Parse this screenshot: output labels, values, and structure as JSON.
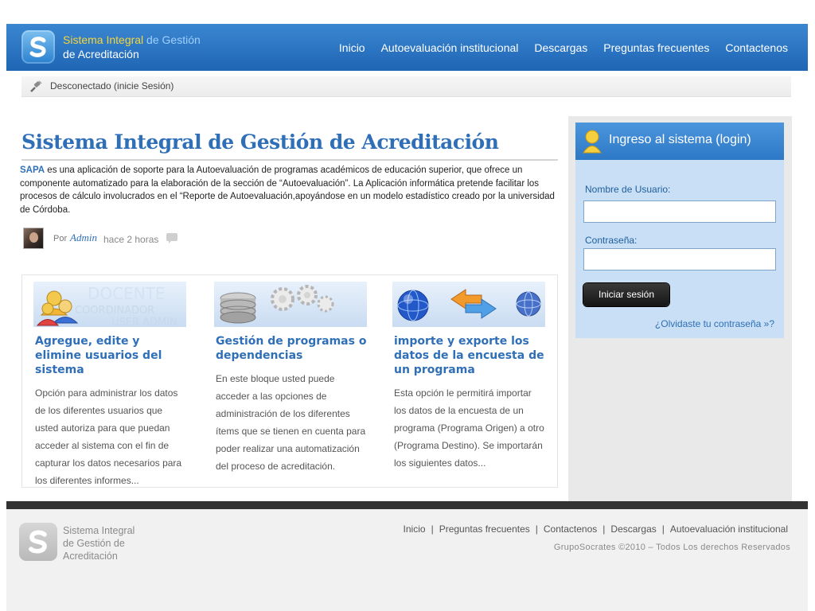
{
  "header": {
    "brand_line1_a": "Sistema Integral",
    "brand_line1_b": " de Gestión",
    "brand_line2": "de Acreditación",
    "nav": [
      "Inicio",
      "Autoevaluación institucional",
      "Descargas",
      "Preguntas frecuentes",
      "Contactenos"
    ]
  },
  "status": {
    "text": "Desconectado (inicie Sesión)"
  },
  "main": {
    "title": "Sistema Integral de Gestión de Acreditación",
    "intro_keyword": "SAPA",
    "intro_text": " es una aplicación de soporte para la Autoevaluación de programas académicos de educación superior, que ofrece un componente automatizado para la elaboración de la sección de “Autoevaluación”. La Aplicación informática pretende facilitar los procesos de cálculo involucrados en el “Reporte de Autoevaluación,apoyándose en un modelo estadístico creado por la universidad de Córdoba.",
    "author_prefix": "Por",
    "author_name": "Admin",
    "author_time": "hace 2 horas"
  },
  "features": [
    {
      "banner_words": [
        "DOCENTE",
        "COORDINADOR",
        "USER ADMIN"
      ],
      "title": "Agregue, edite y elimine usuarios del sistema",
      "body": "Opción para administrar los datos de los diferentes usuarios que usted autoriza para que puedan acceder al sistema con el fin de capturar los datos necesarios para los diferentes informes..."
    },
    {
      "title": "Gestión de programas o dependencias",
      "body": "En este bloque usted puede acceder a las opciones de administración de los diferentes ítems que se tienen en cuenta para poder realizar una automatización del proceso de acreditación."
    },
    {
      "title": "importe y exporte los datos de la encuesta de un programa",
      "body": "Esta opción le permitirá importar los datos de la encuesta de un programa (Programa Origen) a otro (Programa Destino). Se importarán los siguientes datos..."
    }
  ],
  "login": {
    "title": "Ingreso al sistema (login)",
    "user_label": "Nombre de Usuario:",
    "user_value": "",
    "pass_label": "Contraseña:",
    "pass_value": "",
    "submit": "Iniciar sesión",
    "forgot": "¿Olvidaste tu contraseña »?"
  },
  "footer": {
    "brand_l1": "Sistema Integral",
    "brand_l2": "de Gestión de",
    "brand_l3": "Acreditación",
    "links": [
      "Inicio",
      "Preguntas frecuentes",
      "Contactenos",
      "Descargas",
      "Autoevaluación institucional"
    ],
    "copyright": "GrupoSocrates ©2010  – Todos Los derechos Reservados"
  },
  "colors": {
    "brand_blue": "#2f6fb7",
    "header_blue": "#2a72c0",
    "accent_yellow": "#f6d53b"
  },
  "icons": {
    "status": "plug-icon",
    "login": "user-icon",
    "comment": "comment-bubble-icon"
  }
}
